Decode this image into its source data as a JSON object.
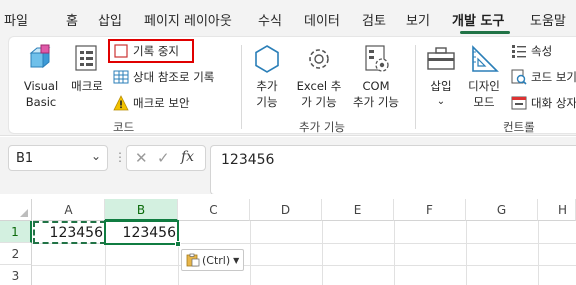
{
  "menu": {
    "tabs": [
      "파일",
      "홈",
      "삽입",
      "페이지 레이아웃",
      "수식",
      "데이터",
      "검토",
      "보기",
      "개발 도구",
      "도움말"
    ],
    "active_tab": "개발 도구"
  },
  "ribbon": {
    "code_group": {
      "visual_basic": "Visual\nBasic",
      "visual_basic_line1": "Visual",
      "visual_basic_line2": "Basic",
      "macro": "매크로",
      "record_stop": "기록 중지",
      "relative_ref": "상대 참조로 기록",
      "macro_security": "매크로 보안",
      "label": "코드"
    },
    "addins_group": {
      "addins_line1": "추가",
      "addins_line2": "기능",
      "excel_addins_line1": "Excel 추",
      "excel_addins_line2": "가 기능",
      "com_addins_line1": "COM",
      "com_addins_line2": "추가 기능",
      "label": "추가 기능"
    },
    "controls_group": {
      "insert": "삽입",
      "design_mode_line1": "디자인",
      "design_mode_line2": "모드",
      "properties": "속성",
      "view_code": "코드 보기",
      "run_dialog": "대화 상자",
      "label": "컨트롤"
    }
  },
  "formula_bar": {
    "name_box": "B1",
    "formula": "123456",
    "fx": "fx"
  },
  "grid": {
    "columns": [
      "A",
      "B",
      "C",
      "D",
      "E",
      "F",
      "G",
      "H"
    ],
    "rows": [
      "1",
      "2",
      "3"
    ],
    "cells": {
      "A1": "123456",
      "B1": "123456"
    },
    "selected_column": "B",
    "selected_row": "1"
  },
  "paste_options": {
    "label": "(Ctrl)"
  },
  "colors": {
    "accent": "#217346",
    "highlight": "#e00000",
    "selected_header": "#d3f0e0"
  }
}
